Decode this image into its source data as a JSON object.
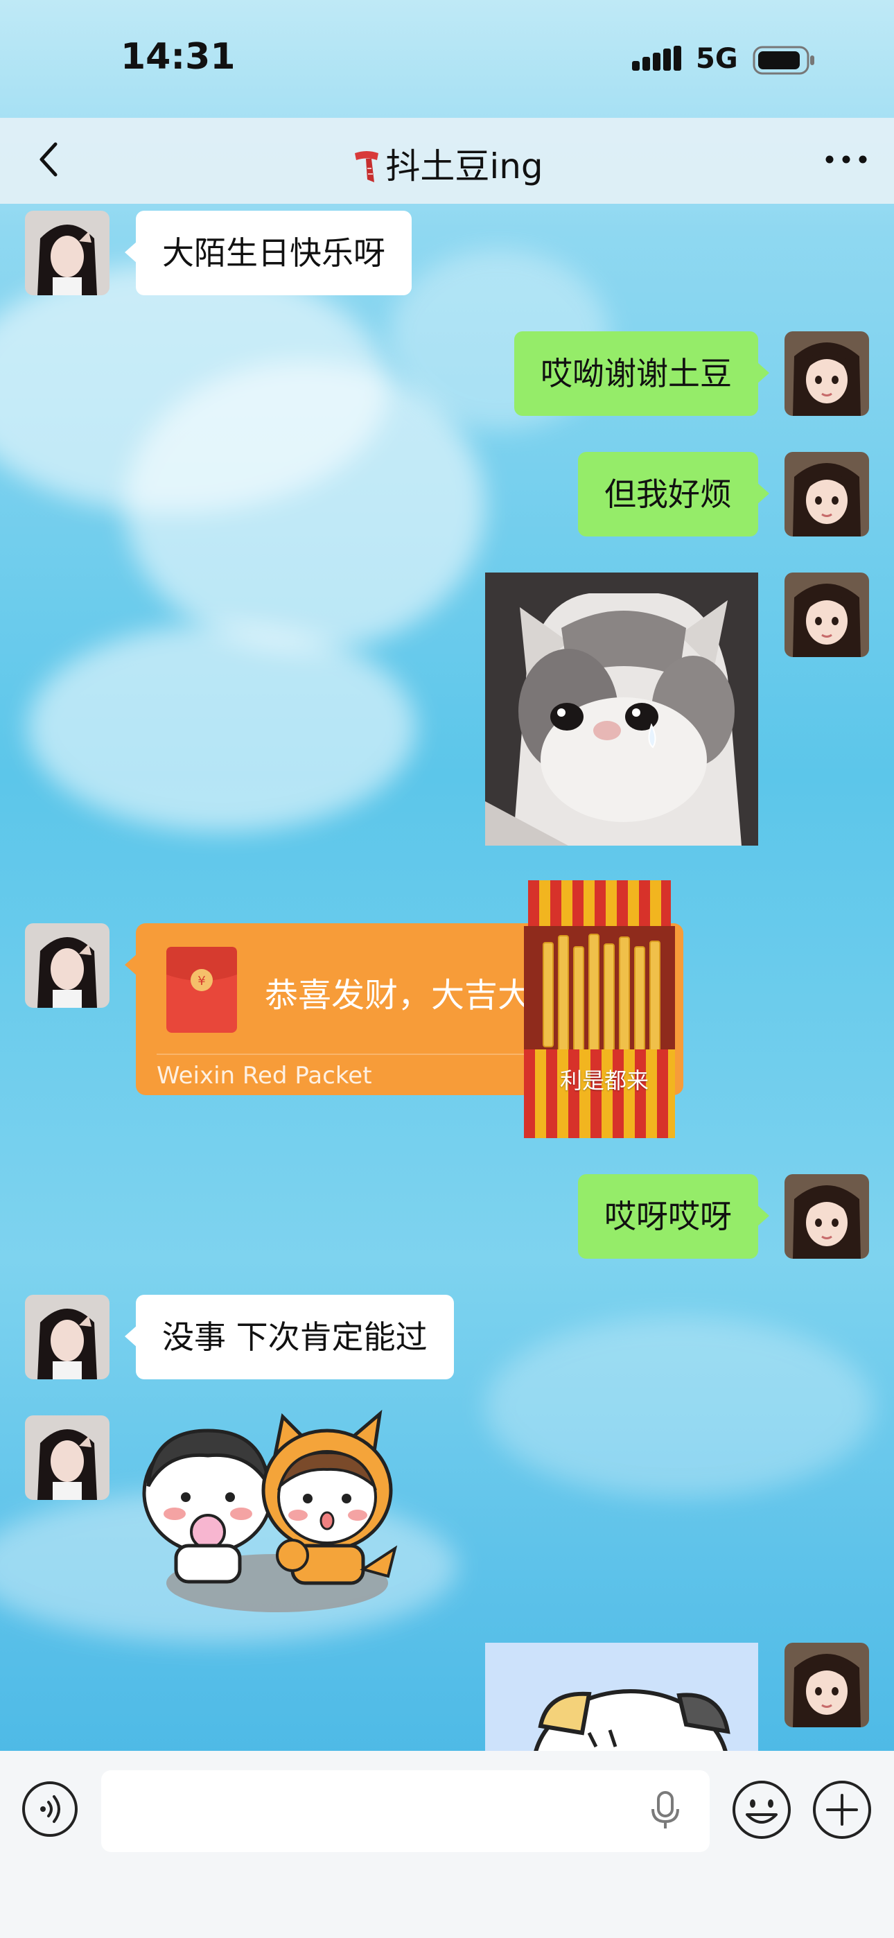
{
  "status_bar": {
    "time": "14:31",
    "network": "5G",
    "icons": [
      "signal-icon",
      "battery-icon"
    ]
  },
  "header": {
    "title": "抖土豆ing",
    "title_icon": "scarf-emoji-icon",
    "back_icon": "chevron-left-icon",
    "more_icon": "more-dots-icon"
  },
  "messages": [
    {
      "side": "in",
      "type": "text",
      "text": "大陌生日快乐呀"
    },
    {
      "side": "out",
      "type": "text",
      "text": "哎呦谢谢土豆"
    },
    {
      "side": "out",
      "type": "text",
      "text": "但我好烦"
    },
    {
      "side": "out",
      "type": "image",
      "image": "crying-kitten-photo"
    },
    {
      "side": "in",
      "type": "red_packet",
      "text": "恭喜发财，大吉大利",
      "label": "Weixin Red Packet",
      "cover_text": "利是都来"
    },
    {
      "side": "out",
      "type": "text",
      "text": "哎呀哎呀"
    },
    {
      "side": "in",
      "type": "text",
      "text": "没事 下次肯定能过"
    },
    {
      "side": "in",
      "type": "sticker",
      "image": "two-cartoon-kids-sticker"
    },
    {
      "side": "out",
      "type": "image",
      "image": "cartoon-cat-image"
    }
  ],
  "input_bar": {
    "placeholder": "",
    "icons": [
      "voice-icon",
      "microphone-icon",
      "emoji-icon",
      "plus-icon"
    ]
  },
  "colors": {
    "outgoing_bubble": "#95ec69",
    "incoming_bubble": "#ffffff",
    "red_packet": "#f79c39"
  }
}
